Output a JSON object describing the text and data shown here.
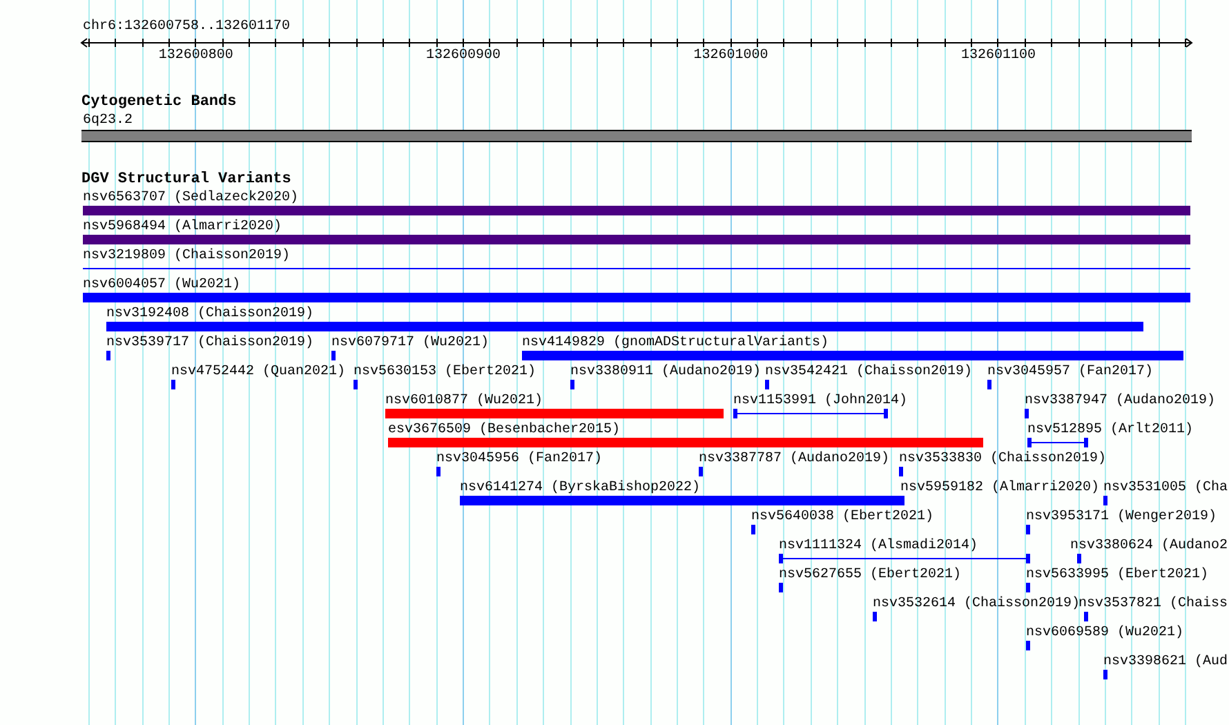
{
  "ruler": {
    "location": "chr6:132600758..132601170",
    "tick_labels": [
      "132600800",
      "132600900",
      "132601000",
      "132601100"
    ]
  },
  "tracks": [
    {
      "title": "Cytogenetic Bands",
      "rows": [
        [
          {
            "label": "6q23.2",
            "kind": "band",
            "color": "#808080"
          }
        ]
      ]
    },
    {
      "title": "DGV Structural Variants",
      "rows": [
        [
          {
            "label": "nsv6563707 (Sedlazeck2020)",
            "kind": "bar",
            "color": "#4b0082"
          }
        ],
        [
          {
            "label": "nsv5968494 (Almarri2020)",
            "kind": "bar",
            "color": "#4b0082"
          }
        ],
        [
          {
            "label": "nsv3219809 (Chaisson2019)",
            "kind": "line",
            "color": "#0000ff"
          }
        ],
        [
          {
            "label": "nsv6004057 (Wu2021)",
            "kind": "bar",
            "color": "#0000ff"
          }
        ],
        [
          {
            "label": "nsv3192408 (Chaisson2019)",
            "kind": "bar",
            "color": "#0000ff"
          }
        ],
        [
          {
            "label": "nsv3539717 (Chaisson2019)",
            "kind": "bar",
            "color": "#0000ff"
          },
          {
            "label": "nsv6079717 (Wu2021)",
            "kind": "bar",
            "color": "#0000ff"
          },
          {
            "label": "nsv4149829 (gnomADStructuralVariants)",
            "kind": "bar",
            "color": "#0000ff"
          }
        ],
        [
          {
            "label": "nsv4752442 (Quan2021)",
            "kind": "bar",
            "color": "#0000ff"
          },
          {
            "label": "nsv5630153 (Ebert2021)",
            "kind": "bar",
            "color": "#0000ff"
          },
          {
            "label": "nsv3380911 (Audano2019)",
            "kind": "bar",
            "color": "#0000ff"
          },
          {
            "label": "nsv3542421 (Chaisson2019)",
            "kind": "bar",
            "color": "#0000ff"
          },
          {
            "label": "nsv3045957 (Fan2017)",
            "kind": "bar",
            "color": "#0000ff"
          }
        ],
        [
          {
            "label": "nsv6010877 (Wu2021)",
            "kind": "bar",
            "color": "#ff0000"
          },
          {
            "label": "nsv1153991 (John2014)",
            "kind": "line",
            "color": "#0000ff"
          },
          {
            "label": "nsv3387947 (Audano2019)",
            "kind": "bar",
            "color": "#0000ff"
          }
        ],
        [
          {
            "label": "esv3676509 (Besenbacher2015)",
            "kind": "bar",
            "color": "#ff0000"
          },
          {
            "label": "nsv512895 (Arlt2011)",
            "kind": "line",
            "color": "#0000ff"
          }
        ],
        [
          {
            "label": "nsv3045956 (Fan2017)",
            "kind": "bar",
            "color": "#0000ff"
          },
          {
            "label": "nsv3387787 (Audano2019)",
            "kind": "bar",
            "color": "#0000ff"
          },
          {
            "label": "nsv3533830 (Chaisson2019)",
            "kind": "bar",
            "color": "#0000ff"
          }
        ],
        [
          {
            "label": "nsv6141274 (ByrskaBishop2022)",
            "kind": "bar",
            "color": "#0000ff"
          },
          {
            "label": "nsv5959182 (Almarri2020)",
            "kind": "bar",
            "color": "#0000ff"
          },
          {
            "label": "nsv3531005 (Cha",
            "kind": "bar",
            "color": "#0000ff"
          }
        ],
        [
          {
            "label": "nsv5640038 (Ebert2021)",
            "kind": "bar",
            "color": "#0000ff"
          },
          {
            "label": "nsv3953171 (Wenger2019)",
            "kind": "bar",
            "color": "#0000ff"
          }
        ],
        [
          {
            "label": "nsv1111324 (Alsmadi2014)",
            "kind": "line",
            "color": "#0000ff"
          },
          {
            "label": "nsv3380624 (Audano2",
            "kind": "bar",
            "color": "#0000ff"
          }
        ],
        [
          {
            "label": "nsv5627655 (Ebert2021)",
            "kind": "bar",
            "color": "#0000ff"
          },
          {
            "label": "nsv5633995 (Ebert2021)",
            "kind": "bar",
            "color": "#0000ff"
          }
        ],
        [
          {
            "label": "nsv3532614 (Chaisson2019)",
            "kind": "bar",
            "color": "#0000ff"
          },
          {
            "label": "nsv3537821 (Chaiss",
            "kind": "bar",
            "color": "#0000ff"
          }
        ],
        [
          {
            "label": "nsv6069589 (Wu2021)",
            "kind": "bar",
            "color": "#0000ff"
          }
        ],
        [
          {
            "label": "nsv3398621 (Aud",
            "kind": "bar",
            "color": "#0000ff"
          }
        ]
      ]
    }
  ]
}
